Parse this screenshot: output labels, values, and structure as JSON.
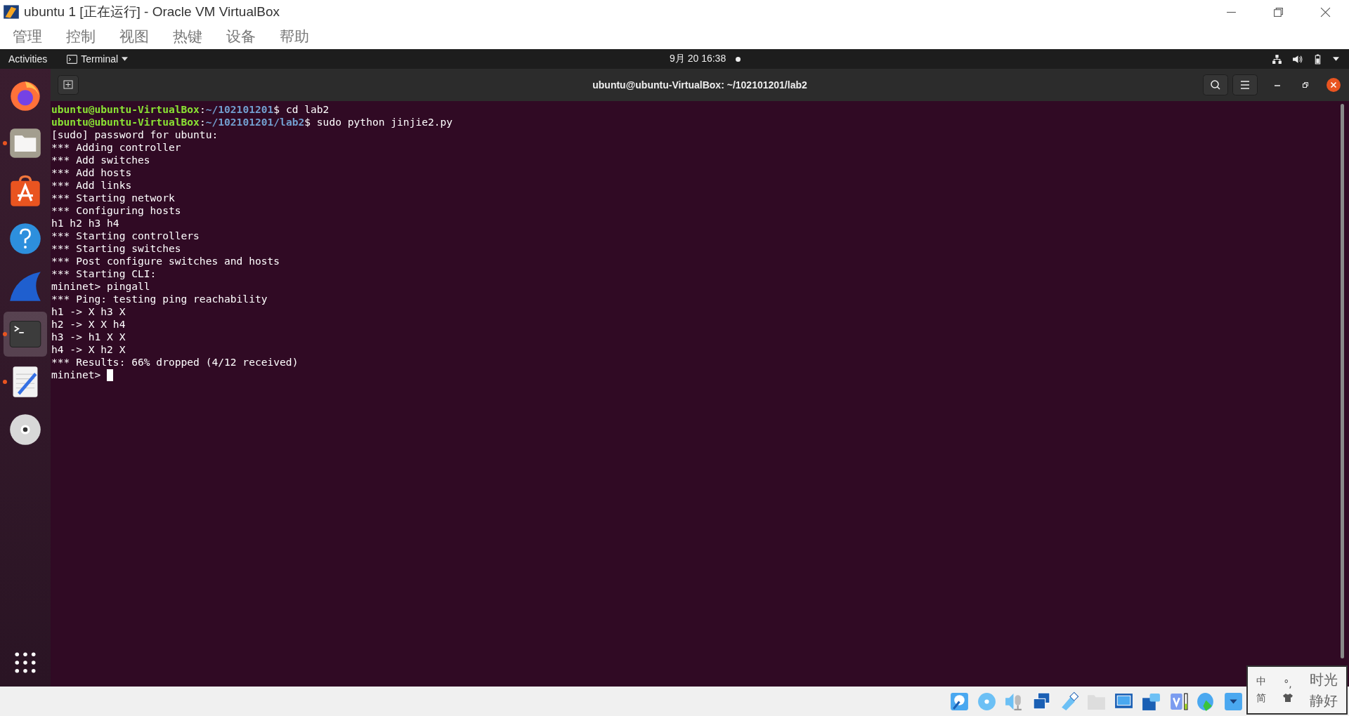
{
  "window": {
    "title": "ubuntu 1 [正在运行] - Oracle VM VirtualBox"
  },
  "menu": [
    "管理",
    "控制",
    "视图",
    "热键",
    "设备",
    "帮助"
  ],
  "topbar": {
    "activities": "Activities",
    "app": "Terminal",
    "clock": "9月 20  16:38"
  },
  "dock": [
    {
      "kind": "firefox",
      "running": false,
      "selected": false
    },
    {
      "kind": "files",
      "running": true,
      "selected": false
    },
    {
      "kind": "store",
      "running": false,
      "selected": false
    },
    {
      "kind": "help",
      "running": false,
      "selected": false
    },
    {
      "kind": "shark",
      "running": false,
      "selected": false
    },
    {
      "kind": "terminal",
      "running": true,
      "selected": true
    },
    {
      "kind": "editor",
      "running": true,
      "selected": false
    },
    {
      "kind": "disc",
      "running": false,
      "selected": false
    }
  ],
  "terminal": {
    "title": "ubuntu@ubuntu-VirtualBox: ~/102101201/lab2",
    "lines": [
      {
        "segments": [
          {
            "kind": "user",
            "text": "ubuntu@ubuntu-VirtualBox"
          },
          {
            "kind": "plain",
            "text": ":"
          },
          {
            "kind": "path",
            "text": "~/102101201"
          },
          {
            "kind": "plain",
            "text": "$ cd lab2"
          }
        ]
      },
      {
        "segments": [
          {
            "kind": "user",
            "text": "ubuntu@ubuntu-VirtualBox"
          },
          {
            "kind": "plain",
            "text": ":"
          },
          {
            "kind": "path",
            "text": "~/102101201/lab2"
          },
          {
            "kind": "plain",
            "text": "$ sudo python jinjie2.py"
          }
        ]
      },
      {
        "segments": [
          {
            "kind": "plain",
            "text": "[sudo] password for ubuntu:"
          }
        ]
      },
      {
        "segments": [
          {
            "kind": "plain",
            "text": "*** Adding controller"
          }
        ]
      },
      {
        "segments": [
          {
            "kind": "plain",
            "text": "*** Add switches"
          }
        ]
      },
      {
        "segments": [
          {
            "kind": "plain",
            "text": "*** Add hosts"
          }
        ]
      },
      {
        "segments": [
          {
            "kind": "plain",
            "text": "*** Add links"
          }
        ]
      },
      {
        "segments": [
          {
            "kind": "plain",
            "text": "*** Starting network"
          }
        ]
      },
      {
        "segments": [
          {
            "kind": "plain",
            "text": "*** Configuring hosts"
          }
        ]
      },
      {
        "segments": [
          {
            "kind": "plain",
            "text": "h1 h2 h3 h4"
          }
        ]
      },
      {
        "segments": [
          {
            "kind": "plain",
            "text": "*** Starting controllers"
          }
        ]
      },
      {
        "segments": [
          {
            "kind": "plain",
            "text": "*** Starting switches"
          }
        ]
      },
      {
        "segments": [
          {
            "kind": "plain",
            "text": "*** Post configure switches and hosts"
          }
        ]
      },
      {
        "segments": [
          {
            "kind": "plain",
            "text": "*** Starting CLI:"
          }
        ]
      },
      {
        "segments": [
          {
            "kind": "plain",
            "text": "mininet> pingall"
          }
        ]
      },
      {
        "segments": [
          {
            "kind": "plain",
            "text": "*** Ping: testing ping reachability"
          }
        ]
      },
      {
        "segments": [
          {
            "kind": "plain",
            "text": "h1 -> X h3 X"
          }
        ]
      },
      {
        "segments": [
          {
            "kind": "plain",
            "text": "h2 -> X X h4"
          }
        ]
      },
      {
        "segments": [
          {
            "kind": "plain",
            "text": "h3 -> h1 X X"
          }
        ]
      },
      {
        "segments": [
          {
            "kind": "plain",
            "text": "h4 -> X h2 X"
          }
        ]
      },
      {
        "segments": [
          {
            "kind": "plain",
            "text": "*** Results: 66% dropped (4/12 received)"
          }
        ]
      },
      {
        "segments": [
          {
            "kind": "plain",
            "text": "mininet> "
          }
        ],
        "cursor": true
      }
    ]
  },
  "statusbar": {
    "icons": [
      {
        "kind": "disk"
      },
      {
        "kind": "optical"
      },
      {
        "kind": "audio"
      },
      {
        "kind": "network"
      },
      {
        "kind": "usb"
      },
      {
        "kind": "folder"
      },
      {
        "kind": "display"
      },
      {
        "kind": "capture"
      },
      {
        "kind": "cpu"
      },
      {
        "kind": "mouse"
      },
      {
        "kind": "arrow"
      }
    ]
  },
  "ime": {
    "lang": "中",
    "mode": "简",
    "punct": "°,",
    "skin_top": "时光",
    "skin_bottom": "静好"
  }
}
